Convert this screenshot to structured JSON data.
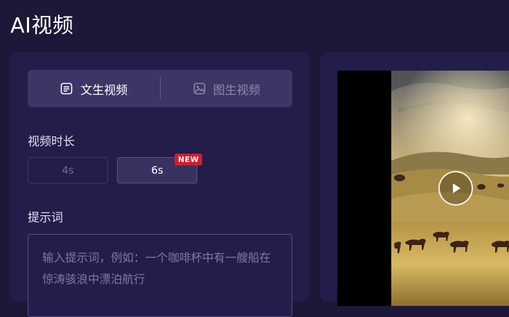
{
  "page": {
    "title": "AI视频"
  },
  "tabs": [
    {
      "label": "文生视频",
      "icon": "document-icon",
      "active": true
    },
    {
      "label": "图生视频",
      "icon": "image-icon",
      "active": false
    }
  ],
  "duration": {
    "label": "视频时长",
    "options": [
      {
        "label": "4s",
        "selected": false
      },
      {
        "label": "6s",
        "selected": true,
        "badge": "NEW"
      }
    ]
  },
  "prompt": {
    "label": "提示词",
    "placeholder": "输入提示词，例如：一个咖啡杯中有一艘船在惊涛骇浪中漂泊航行"
  },
  "preview": {
    "play_icon": "play-icon"
  },
  "colors": {
    "background": "#1c1838",
    "panel": "#231d49",
    "tab_bar": "#3b3666",
    "badge": "#cf1f2e"
  }
}
